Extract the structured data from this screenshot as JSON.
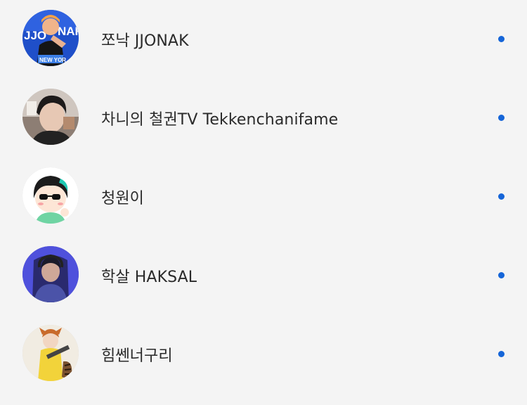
{
  "channels": [
    {
      "name": "쪼낙 JJONAK",
      "avatar_icon": "avatar-jjonak",
      "indicator_color": "#1565d8"
    },
    {
      "name": "차니의 철권TV Tekkenchanifame",
      "avatar_icon": "avatar-chani",
      "indicator_color": "#1565d8"
    },
    {
      "name": "청원이",
      "avatar_icon": "avatar-cheongwon",
      "indicator_color": "#1565d8"
    },
    {
      "name": "학살 HAKSAL",
      "avatar_icon": "avatar-haksal",
      "indicator_color": "#1565d8"
    },
    {
      "name": "힘쎈너구리",
      "avatar_icon": "avatar-raccoon",
      "indicator_color": "#1565d8"
    }
  ]
}
